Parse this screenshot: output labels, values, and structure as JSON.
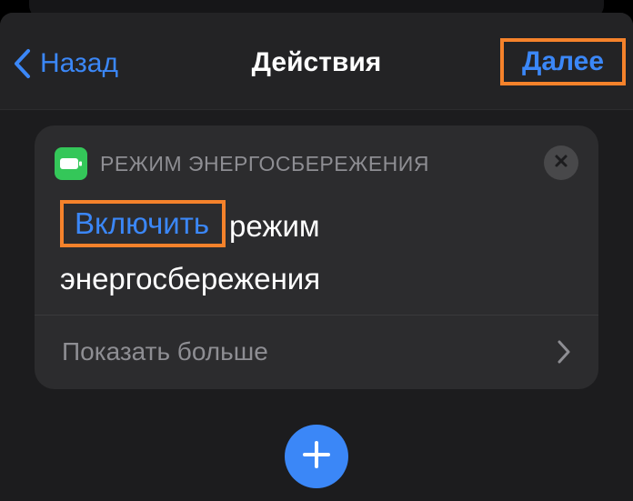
{
  "navbar": {
    "back_label": "Назад",
    "title": "Действия",
    "next_label": "Далее"
  },
  "action_card": {
    "category": "РЕЖИМ ЭНЕРГОСБЕРЕЖЕНИЯ",
    "parameter": "Включить",
    "text_rest": "режим энергосбережения",
    "show_more_label": "Показать больше"
  },
  "icons": {
    "back": "chevron-left-icon",
    "app": "battery-icon",
    "close": "close-icon",
    "show_more": "chevron-right-icon",
    "add": "plus-icon"
  },
  "colors": {
    "accent": "#3b87f7",
    "highlight": "#f5822b",
    "app_icon": "#34c759",
    "background": "#1c1c1e",
    "card": "#2c2c2e"
  }
}
